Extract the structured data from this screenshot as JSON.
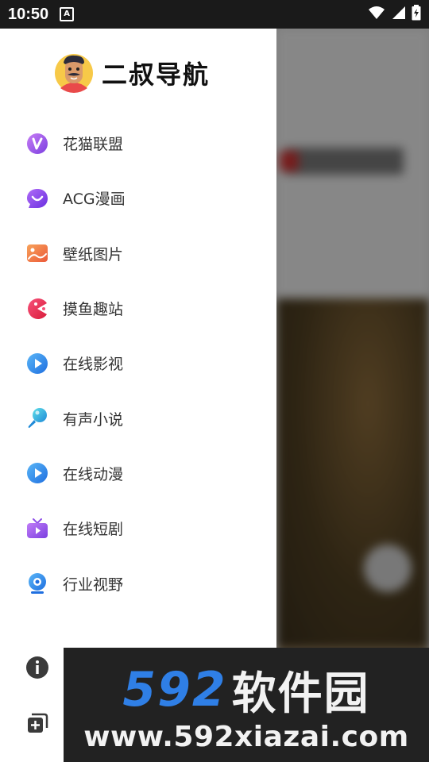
{
  "status_bar": {
    "time": "10:50",
    "notification_glyph": "A",
    "icons": [
      "wifi-icon",
      "signal-icon",
      "battery-icon"
    ]
  },
  "drawer": {
    "title": "二叔导航",
    "items": [
      {
        "label": "花猫联盟",
        "icon": "v-badge-icon",
        "color": "#9b59e6"
      },
      {
        "label": "ACG漫画",
        "icon": "smile-bubble-icon",
        "color": "#8e44ef"
      },
      {
        "label": "壁纸图片",
        "icon": "image-icon",
        "color": "#f07a3a"
      },
      {
        "label": "摸鱼趣站",
        "icon": "pacman-icon",
        "color": "#e8344e"
      },
      {
        "label": "在线影视",
        "icon": "play-circle-icon",
        "color": "#2f86e8"
      },
      {
        "label": "有声小说",
        "icon": "microphone-icon",
        "color": "#23b0d8"
      },
      {
        "label": "在线动漫",
        "icon": "play-circle-icon",
        "color": "#2f86e8"
      },
      {
        "label": "在线短剧",
        "icon": "tv-icon",
        "color": "#9a4ee8"
      },
      {
        "label": "行业视野",
        "icon": "webcam-icon",
        "color": "#2f86e8"
      }
    ],
    "bottom_icons": [
      "info-icon",
      "add-copy-icon"
    ]
  },
  "watermark": {
    "number": "592",
    "name": "软件园",
    "url": "www.592xiazai.com"
  }
}
